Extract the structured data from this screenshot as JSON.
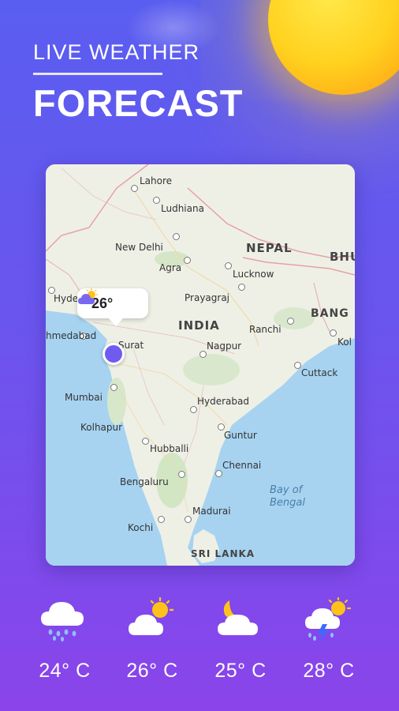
{
  "header": {
    "subtitle": "LIVE WEATHER",
    "title": "FORECAST"
  },
  "map": {
    "countries": {
      "nepal": "NEPAL",
      "india": "INDIA",
      "sri_lanka": "SRI LANKA",
      "bhutan": "BHU",
      "bangladesh": "BANG"
    },
    "cities": {
      "lahore": "Lahore",
      "ludhiana": "Ludhiana",
      "new_delhi": "New Delhi",
      "agra": "Agra",
      "lucknow": "Lucknow",
      "prayagraj": "Prayagraj",
      "hyd_west": "Hyde",
      "ahmedabad": "hmedabad",
      "surat": "Surat",
      "ranchi": "Ranchi",
      "kolkata": "Kol",
      "nagpur": "Nagpur",
      "cuttack": "Cuttack",
      "mumbai": "Mumbai",
      "hyderabad": "Hyderabad",
      "kolhapur": "Kolhapur",
      "guntur": "Guntur",
      "hubballi": "Hubballi",
      "chennai": "Chennai",
      "bengaluru": "Bengaluru",
      "madurai": "Madurai",
      "kochi": "Kochi"
    },
    "sea": "Bay of\nBengal",
    "pin": {
      "temperature": "26°",
      "icon": "cloud-sun-icon"
    }
  },
  "forecast": [
    {
      "icon": "rain-cloud-icon",
      "temp": "24° C"
    },
    {
      "icon": "cloud-sun-icon",
      "temp": "26° C"
    },
    {
      "icon": "cloud-moon-icon",
      "temp": "25° C"
    },
    {
      "icon": "storm-cloud-icon",
      "temp": "28° C"
    }
  ],
  "colors": {
    "accent": "#6f5bf0",
    "sun": "#ffd21f",
    "water": "#a7d3f1",
    "land": "#eef0e6"
  }
}
